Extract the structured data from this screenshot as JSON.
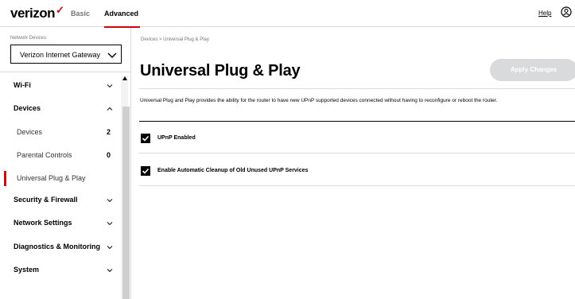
{
  "header": {
    "logo_text": "verizon",
    "logo_mark": "✓",
    "tabs": [
      {
        "label": "Basic",
        "active": false
      },
      {
        "label": "Advanced",
        "active": true
      }
    ],
    "help_label": "Help",
    "user_icon": "user-circle-icon",
    "accent_color": "#cd040b"
  },
  "sidebar": {
    "network_devices_label": "Network Devices",
    "network_devices_selected": "Verizon Internet Gateway",
    "items": [
      {
        "label": "Wi-Fi",
        "type": "section",
        "expanded": false
      },
      {
        "label": "Devices",
        "type": "section",
        "expanded": true
      },
      {
        "label": "Devices",
        "type": "sub",
        "count": "2"
      },
      {
        "label": "Parental Controls",
        "type": "sub",
        "count": "0"
      },
      {
        "label": "Universal Plug & Play",
        "type": "sub",
        "active": true
      },
      {
        "label": "Security & Firewall",
        "type": "section",
        "expanded": false
      },
      {
        "label": "Network Settings",
        "type": "section",
        "expanded": false
      },
      {
        "label": "Diagnostics & Monitoring",
        "type": "section",
        "expanded": false
      },
      {
        "label": "System",
        "type": "section",
        "expanded": false
      }
    ]
  },
  "main": {
    "breadcrumb": "Devices  >  Universal Plug & Play",
    "title": "Universal Plug & Play",
    "apply_label": "Apply Changes",
    "description": "Universal Plug and Play provides the ability for the router to have new UPnP supported devices connected without having to reconfigure or reboot the router.",
    "options": [
      {
        "label": "UPnP Enabled",
        "checked": true
      },
      {
        "label": "Enable Automatic Cleanup of Old Unused UPnP Services",
        "checked": true
      }
    ]
  }
}
